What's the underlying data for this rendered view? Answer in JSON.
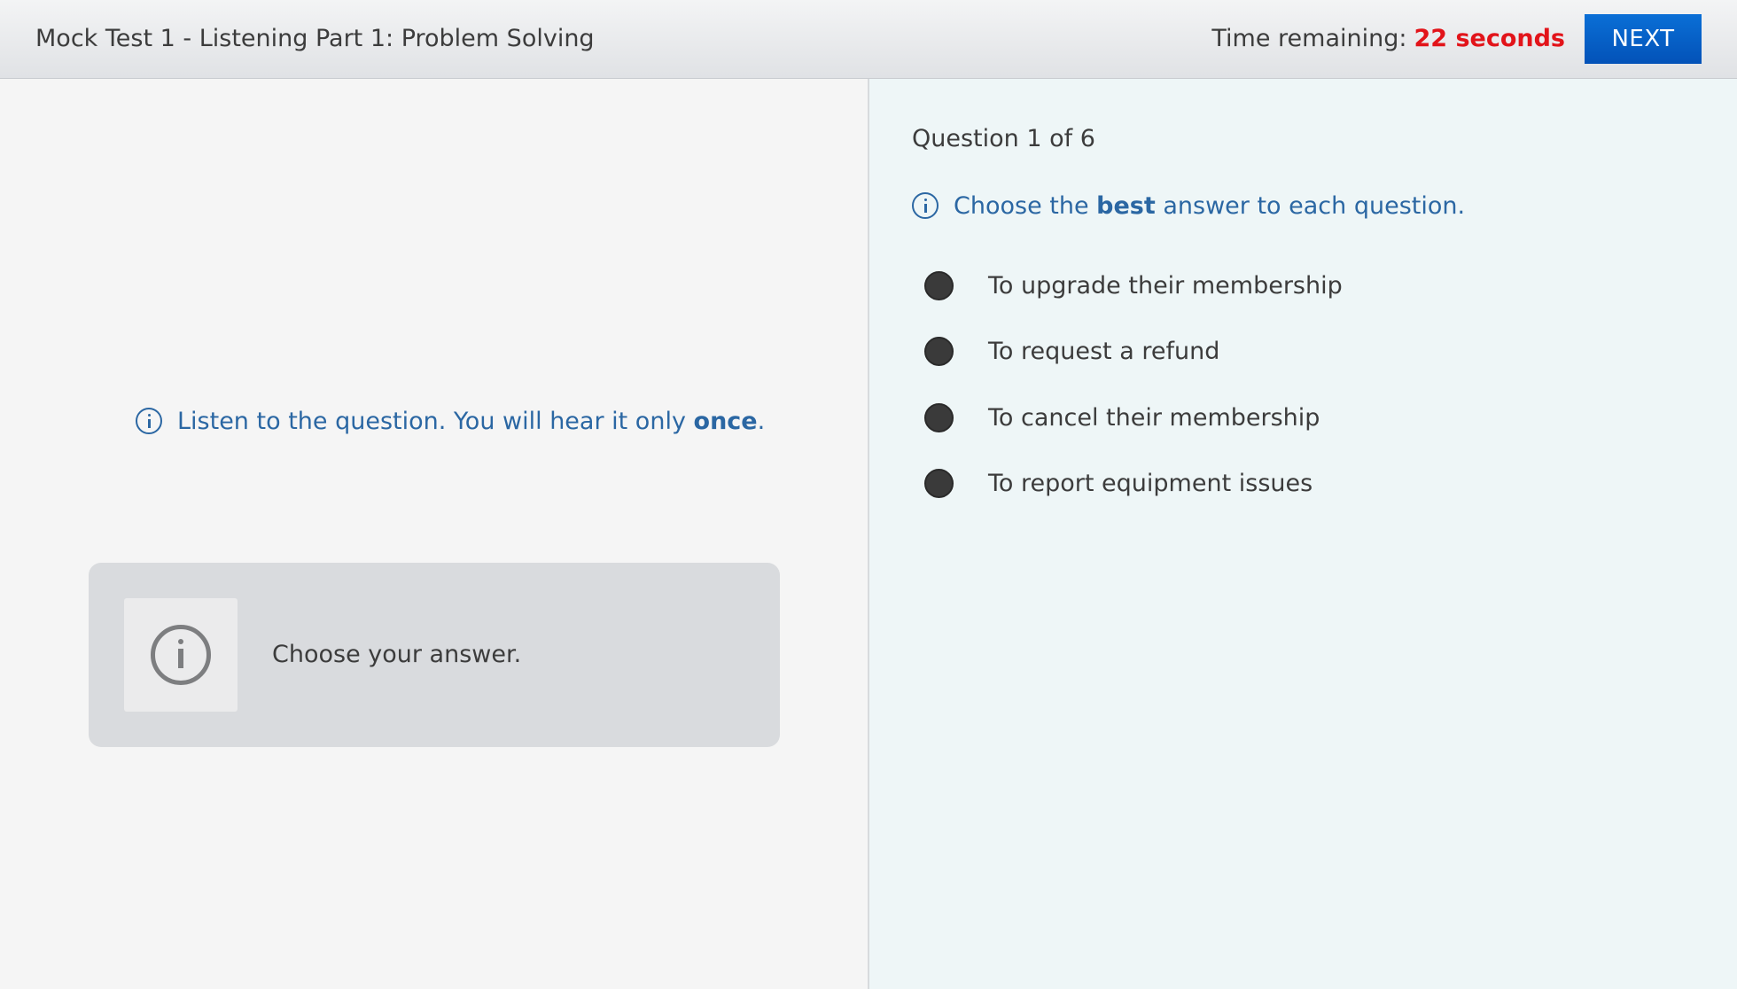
{
  "header": {
    "title": "Mock Test 1 - Listening Part 1: Problem Solving",
    "timer_label": "Time remaining:",
    "timer_value": "22 seconds",
    "next_label": "NEXT"
  },
  "left": {
    "instruction": {
      "prefix": "Listen to the question. You will hear it only ",
      "emphasis": "once",
      "suffix": "."
    },
    "answer_box": {
      "text": "Choose your answer."
    }
  },
  "right": {
    "question_counter": "Question 1 of 6",
    "instruction": {
      "prefix": "Choose the ",
      "emphasis": "best",
      "suffix": " answer to each question."
    },
    "options": [
      {
        "label": "To upgrade their membership"
      },
      {
        "label": "To request a refund"
      },
      {
        "label": "To cancel their membership"
      },
      {
        "label": "To report equipment issues"
      }
    ]
  },
  "colors": {
    "timer_value": "#e2141a",
    "next_button": "#0352b8",
    "instruction_text": "#2b67a3",
    "left_panel_bg": "#f5f5f5",
    "right_panel_bg": "#eef6f7",
    "answer_box_bg": "#d9dbde"
  },
  "icons": {
    "instruction_info": "info-icon",
    "answer_box_info": "info-icon"
  }
}
